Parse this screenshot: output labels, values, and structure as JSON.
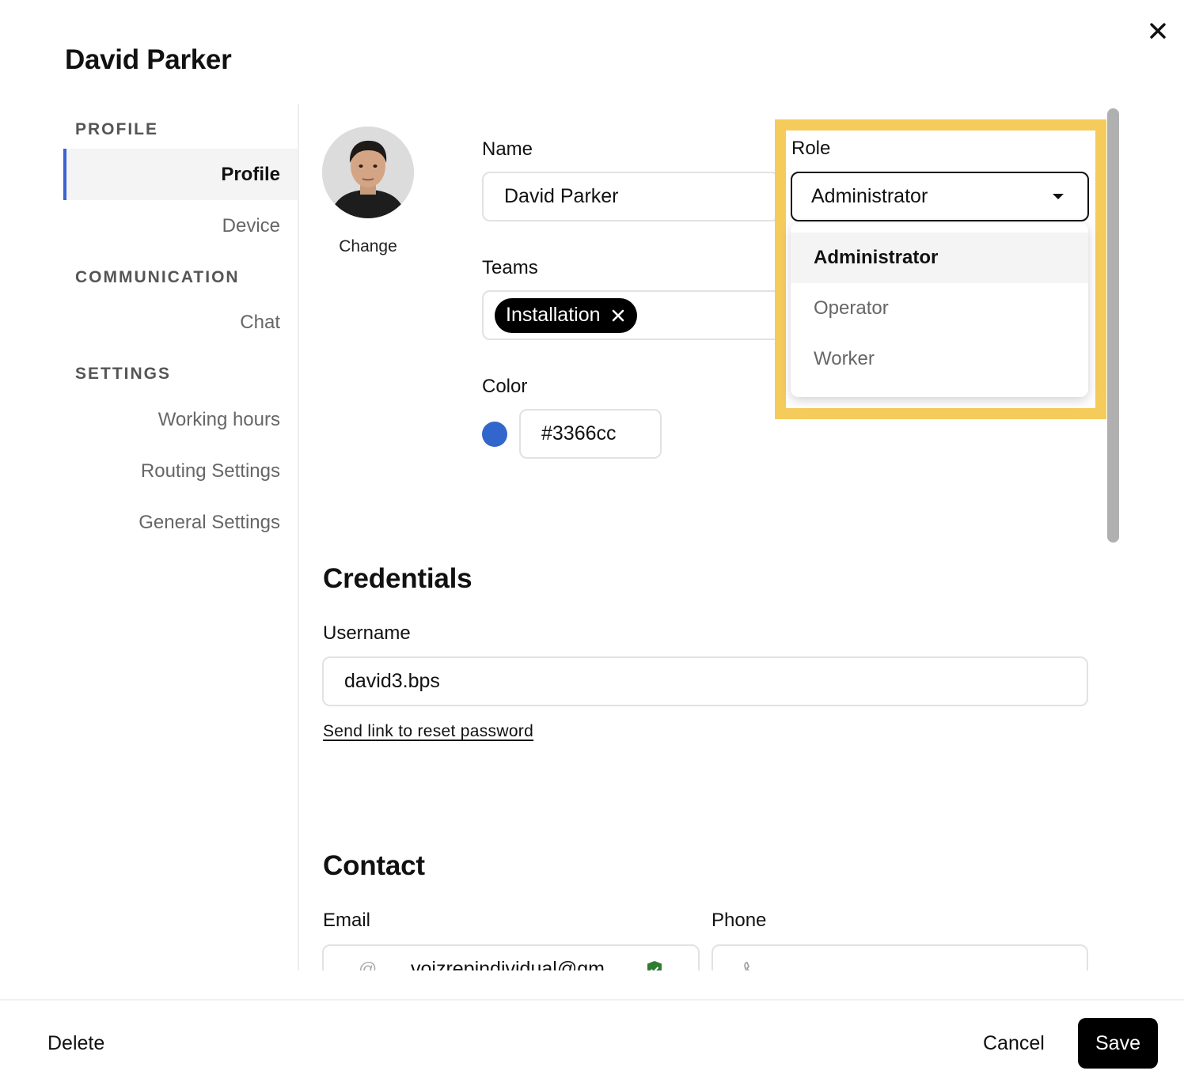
{
  "dialog": {
    "title": "David Parker"
  },
  "sidebar": {
    "sections": [
      {
        "label": "PROFILE",
        "items": [
          {
            "label": "Profile",
            "active": true
          },
          {
            "label": "Device"
          }
        ]
      },
      {
        "label": "COMMUNICATION",
        "items": [
          {
            "label": "Chat"
          }
        ]
      },
      {
        "label": "SETTINGS",
        "items": [
          {
            "label": "Working hours"
          },
          {
            "label": "Routing Settings"
          },
          {
            "label": "General Settings"
          }
        ]
      }
    ]
  },
  "profile": {
    "avatar_change_label": "Change",
    "name_label": "Name",
    "name_value": "David Parker",
    "teams_label": "Teams",
    "teams": [
      "Installation"
    ],
    "color_label": "Color",
    "color_value": "#3366cc",
    "role_label": "Role",
    "role_value": "Administrator",
    "role_options": [
      "Administrator",
      "Operator",
      "Worker"
    ]
  },
  "credentials": {
    "heading": "Credentials",
    "username_label": "Username",
    "username_value": "david3.bps",
    "reset_link": "Send link to reset password"
  },
  "contact": {
    "heading": "Contact",
    "email_label": "Email",
    "email_value": "voizrepindividual@gm",
    "phone_label": "Phone"
  },
  "footer": {
    "delete_label": "Delete",
    "cancel_label": "Cancel",
    "save_label": "Save"
  },
  "colors": {
    "accent": "#3b63d4",
    "highlight": "#f5cb5c",
    "verified": "#2e7d32"
  }
}
